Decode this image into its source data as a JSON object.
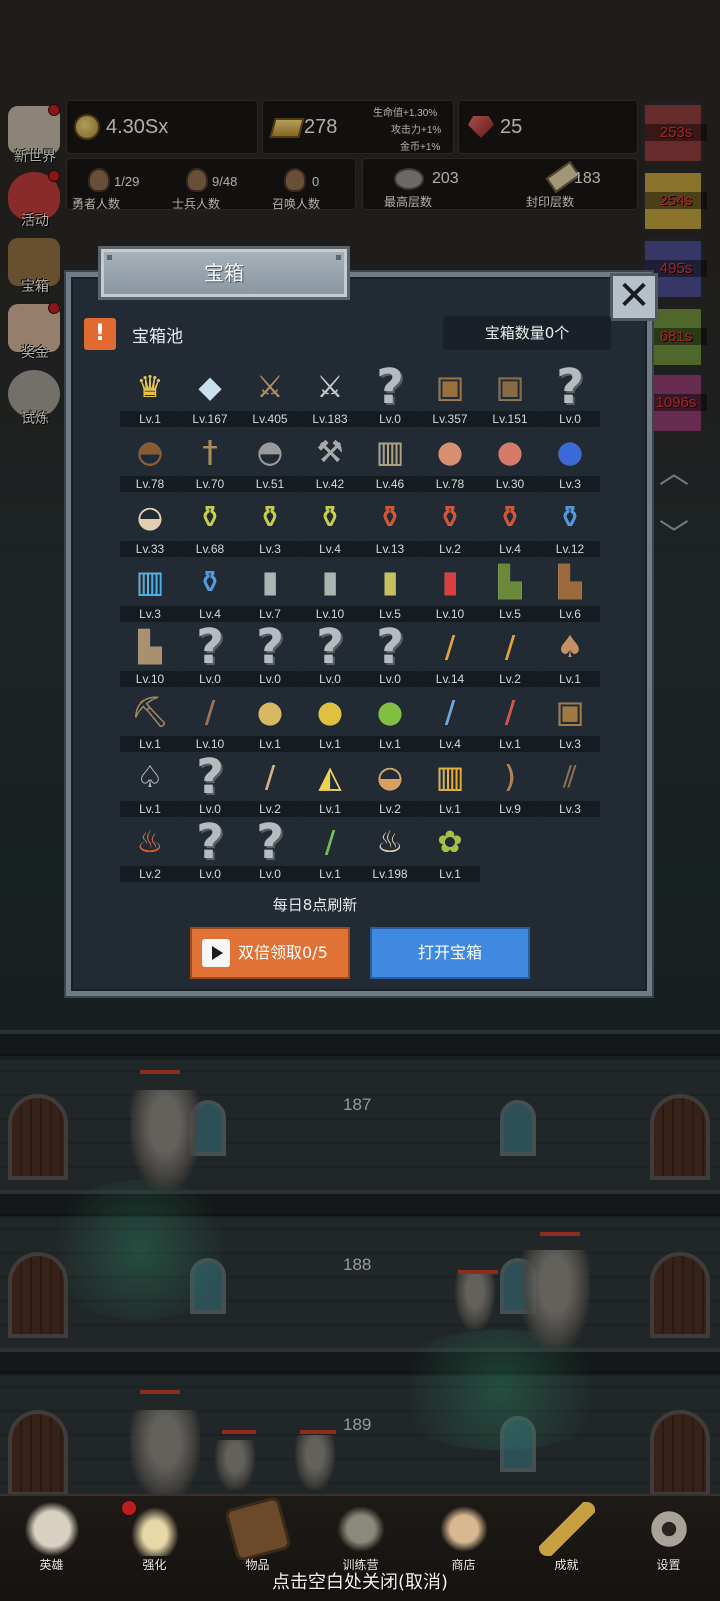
{
  "hud": {
    "gold": "4.30Sx",
    "bars": "278",
    "bonus_hp": "生命值+1.30%",
    "bonus_atk": "攻击力+1%",
    "bonus_gold": "金币+1%",
    "gems": "25",
    "heroes_value": "1/29",
    "heroes_label": "勇者人数",
    "soldiers_value": "9/48",
    "soldiers_label": "士兵人数",
    "summons_value": "0",
    "summons_label": "召唤人数",
    "max_floor_value": "203",
    "max_floor_label": "最高层数",
    "seal_floor_value": "183",
    "seal_floor_label": "封印层数"
  },
  "side_menu": [
    {
      "label": "新世界"
    },
    {
      "label": "活动"
    },
    {
      "label": "宝箱"
    },
    {
      "label": "奖金"
    },
    {
      "label": "试炼"
    }
  ],
  "timers": [
    "253s",
    "254s",
    "495s",
    "681s",
    "1096s"
  ],
  "modal": {
    "title": "宝箱",
    "pool_label": "宝箱池",
    "chest_count": "宝箱数量0个",
    "refresh_note": "每日8点刷新",
    "double_button": "双倍领取0/5",
    "open_button": "打开宝箱"
  },
  "items": [
    {
      "icon": "crown-icon",
      "level": "Lv.1"
    },
    {
      "icon": "diamond-icon",
      "level": "Lv.167"
    },
    {
      "icon": "wooden-sword-icon",
      "level": "Lv.405"
    },
    {
      "icon": "iron-sword-icon",
      "level": "Lv.183"
    },
    {
      "icon": "unknown-icon",
      "level": "Lv.0"
    },
    {
      "icon": "leather-armor-icon",
      "level": "Lv.357"
    },
    {
      "icon": "backpack-armor-icon",
      "level": "Lv.151"
    },
    {
      "icon": "unknown-icon",
      "level": "Lv.0"
    },
    {
      "icon": "leather-helmet-icon",
      "level": "Lv.78"
    },
    {
      "icon": "dagger-icon",
      "level": "Lv.70"
    },
    {
      "icon": "knight-helmet-icon",
      "level": "Lv.51"
    },
    {
      "icon": "hammer-icon",
      "level": "Lv.42"
    },
    {
      "icon": "great-helm-icon",
      "level": "Lv.46"
    },
    {
      "icon": "ham-icon",
      "level": "Lv.78"
    },
    {
      "icon": "steak-icon",
      "level": "Lv.30"
    },
    {
      "icon": "blue-sack-icon",
      "level": "Lv.3"
    },
    {
      "icon": "bread-icon",
      "level": "Lv.33"
    },
    {
      "icon": "yellow-potion-icon",
      "level": "Lv.68"
    },
    {
      "icon": "yellow-potion-icon",
      "level": "Lv.3"
    },
    {
      "icon": "yellow-potion-icon",
      "level": "Lv.4"
    },
    {
      "icon": "red-potion-icon",
      "level": "Lv.13"
    },
    {
      "icon": "red-potion-icon",
      "level": "Lv.2"
    },
    {
      "icon": "red-potion-icon",
      "level": "Lv.4"
    },
    {
      "icon": "blue-potion-icon",
      "level": "Lv.12"
    },
    {
      "icon": "blue-jar-icon",
      "level": "Lv.3"
    },
    {
      "icon": "blue-potion-icon",
      "level": "Lv.4"
    },
    {
      "icon": "grey-vial-icon",
      "level": "Lv.7"
    },
    {
      "icon": "grey-vial-icon",
      "level": "Lv.10"
    },
    {
      "icon": "yellow-bottle-icon",
      "level": "Lv.5"
    },
    {
      "icon": "red-bottle-icon",
      "level": "Lv.10"
    },
    {
      "icon": "winged-boot-icon",
      "level": "Lv.5"
    },
    {
      "icon": "leather-boot-icon",
      "level": "Lv.6"
    },
    {
      "icon": "old-boot-icon",
      "level": "Lv.10"
    },
    {
      "icon": "unknown-icon",
      "level": "Lv.0"
    },
    {
      "icon": "unknown-icon",
      "level": "Lv.0"
    },
    {
      "icon": "unknown-icon",
      "level": "Lv.0"
    },
    {
      "icon": "unknown-icon",
      "level": "Lv.0"
    },
    {
      "icon": "torch-icon",
      "level": "Lv.14"
    },
    {
      "icon": "torch-icon",
      "level": "Lv.2"
    },
    {
      "icon": "mushroom-icon",
      "level": "Lv.1"
    },
    {
      "icon": "pickaxe-icon",
      "level": "Lv.1"
    },
    {
      "icon": "wooden-staff-icon",
      "level": "Lv.10"
    },
    {
      "icon": "potatoes-icon",
      "level": "Lv.1"
    },
    {
      "icon": "golden-fruit-icon",
      "level": "Lv.1"
    },
    {
      "icon": "green-fruit-icon",
      "level": "Lv.1"
    },
    {
      "icon": "blue-wand-icon",
      "level": "Lv.4"
    },
    {
      "icon": "red-wand-icon",
      "level": "Lv.1"
    },
    {
      "icon": "travel-bag-icon",
      "level": "Lv.3"
    },
    {
      "icon": "shovel-icon",
      "level": "Lv.1"
    },
    {
      "icon": "unknown-icon",
      "level": "Lv.0"
    },
    {
      "icon": "spiked-club-icon",
      "level": "Lv.2"
    },
    {
      "icon": "cheese-icon",
      "level": "Lv.1"
    },
    {
      "icon": "pie-icon",
      "level": "Lv.2"
    },
    {
      "icon": "honey-jar-icon",
      "level": "Lv.1"
    },
    {
      "icon": "bow-icon",
      "level": "Lv.9"
    },
    {
      "icon": "quiver-icon",
      "level": "Lv.3"
    },
    {
      "icon": "fire-emblem-icon",
      "level": "Lv.2"
    },
    {
      "icon": "unknown-icon",
      "level": "Lv.0"
    },
    {
      "icon": "unknown-icon",
      "level": "Lv.0"
    },
    {
      "icon": "green-wand-icon",
      "level": "Lv.1"
    },
    {
      "icon": "beer-mug-icon",
      "level": "Lv.198"
    },
    {
      "icon": "herb-vine-icon",
      "level": "Lv.1"
    }
  ],
  "floors": [
    "187",
    "188",
    "189"
  ],
  "bottom_nav": [
    {
      "label": "英雄"
    },
    {
      "label": "强化"
    },
    {
      "label": "物品"
    },
    {
      "label": "训练营"
    },
    {
      "label": "商店"
    },
    {
      "label": "成就"
    },
    {
      "label": "设置"
    }
  ],
  "close_hint": "点击空白处关闭(取消)",
  "colors": {
    "accent_orange": "#e07236",
    "accent_blue": "#3f8ae0",
    "timer_red": "#e03030",
    "modal_bg": "#222b34"
  }
}
